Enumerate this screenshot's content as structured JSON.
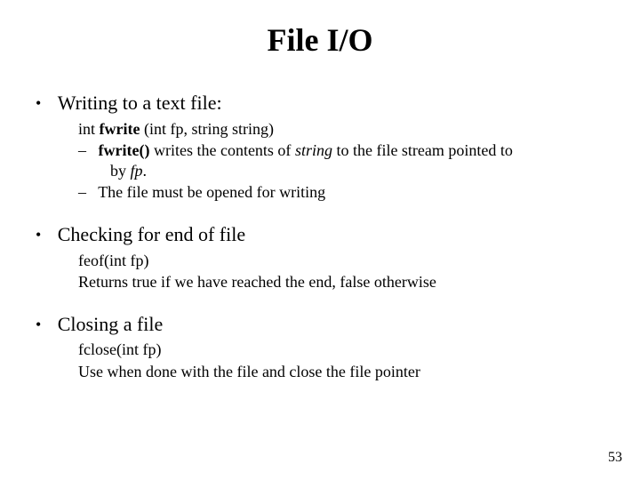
{
  "title": "File I/O",
  "sections": [
    {
      "head": "Writing to a text file:",
      "sig_pre": "int ",
      "sig_bold": "fwrite ",
      "sig_post": "(int fp, string string)",
      "dash": [
        {
          "bold": "fwrite()",
          "mid": " writes the contents of ",
          "ital": "string",
          "post": " to the file stream pointed to",
          "cont_pre": "by ",
          "cont_ital": "fp",
          "cont_post": "."
        },
        {
          "plain": "The file must be opened for writing"
        }
      ]
    },
    {
      "head": "Checking for end of file",
      "line1": "feof(int fp)",
      "line2": "Returns true if we have reached the end, false otherwise"
    },
    {
      "head": "Closing a file",
      "line1": "fclose(int fp)",
      "line2": "Use when done with the file and close the file pointer"
    }
  ],
  "page_number": "53"
}
